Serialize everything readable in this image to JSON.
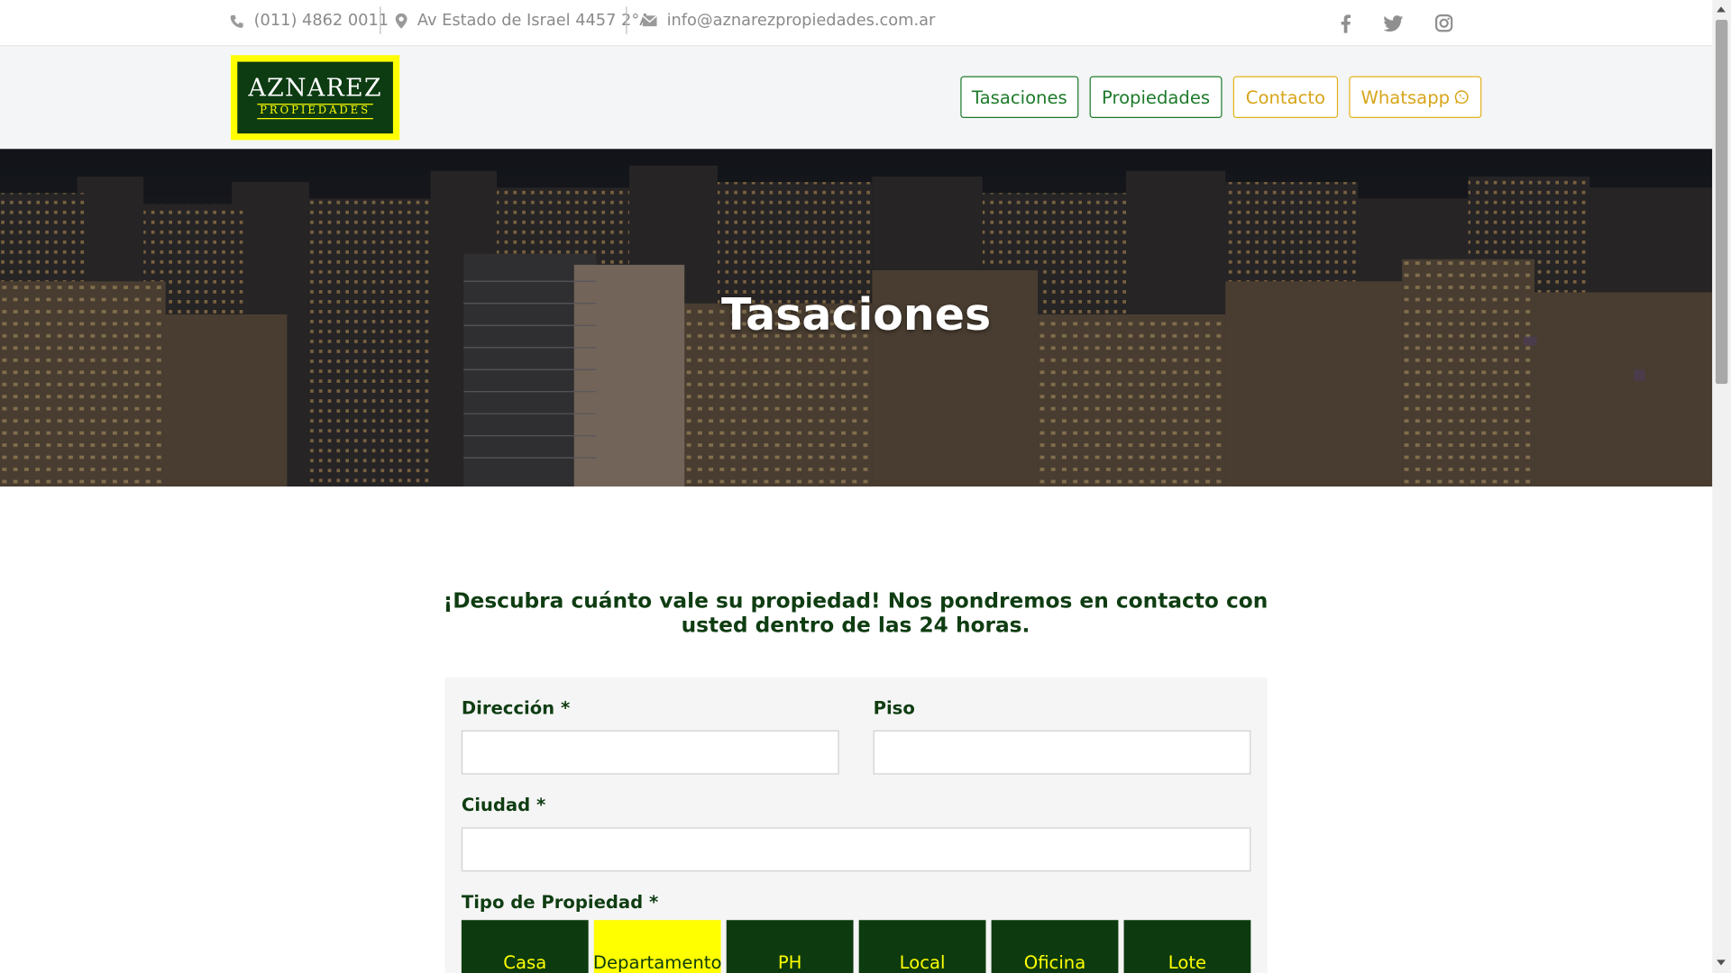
{
  "topbar": {
    "phone": "(011) 4862 0011",
    "address": "Av Estado de Israel 4457 2°A",
    "email": "info@aznarezpropiedades.com.ar",
    "social": [
      "facebook-icon",
      "twitter-icon",
      "instagram-icon"
    ]
  },
  "logo": {
    "main": "AZNAREZ",
    "sub": "PROPIEDADES"
  },
  "nav": {
    "tasaciones": "Tasaciones",
    "propiedades": "Propiedades",
    "contacto": "Contacto",
    "whatsapp": "Whatsapp"
  },
  "hero": {
    "title": "Tasaciones"
  },
  "main": {
    "headline": "¡Descubra cuánto vale su propiedad! Nos pondremos en contacto con usted dentro de las 24 horas."
  },
  "form": {
    "direccion_label": "Dirección *",
    "piso_label": "Piso",
    "ciudad_label": "Ciudad *",
    "tipo_label": "Tipo de Propiedad *",
    "direccion_value": "",
    "piso_value": "",
    "ciudad_value": "",
    "tipos": [
      "Casa",
      "Departamento",
      "PH",
      "Local",
      "Oficina",
      "Lote"
    ],
    "selected_tipo": "Departamento"
  },
  "colors": {
    "brand_green": "#0d3b0f",
    "brand_yellow": "#ffff00",
    "nav_green": "#1d7a2a",
    "nav_yellow": "#d8a51a"
  }
}
